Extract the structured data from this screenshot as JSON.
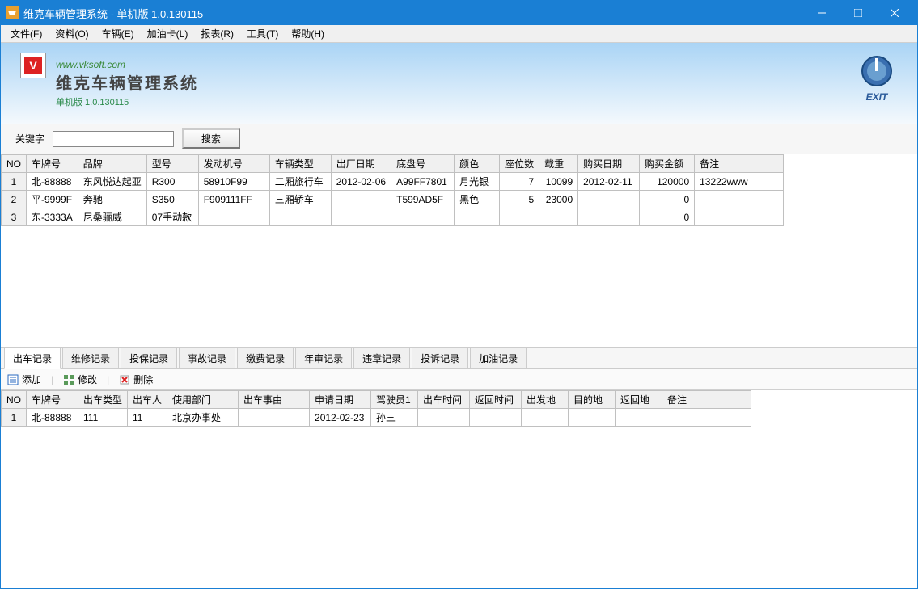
{
  "window": {
    "title": "维克车辆管理系统 - 单机版 1.0.130115"
  },
  "menu": {
    "file": "文件(F)",
    "data": "资料(O)",
    "vehicle": "车辆(E)",
    "fuelcard": "加油卡(L)",
    "report": "报表(R)",
    "tool": "工具(T)",
    "help": "帮助(H)"
  },
  "banner": {
    "url": "www.vksoft.com",
    "app_name": "维克车辆管理系统",
    "edition": "单机版 1.0.130115",
    "exit": "EXIT",
    "logo_letter": "V"
  },
  "search": {
    "label": "关键字",
    "value": "",
    "button": "搜索"
  },
  "vehicle_table": {
    "headers": {
      "no": "NO",
      "plate": "车牌号",
      "brand": "品牌",
      "model": "型号",
      "engine": "发动机号",
      "type": "车辆类型",
      "factory_date": "出厂日期",
      "chassis": "底盘号",
      "color": "颜色",
      "seats": "座位数",
      "load": "载重",
      "buy_date": "购买日期",
      "buy_amount": "购买金额",
      "remark": "备注"
    },
    "rows": [
      {
        "no": "1",
        "plate": "北-88888",
        "brand": "东风悦达起亚",
        "model": "R300",
        "engine": "58910F99",
        "type": "二厢旅行车",
        "factory_date": "2012-02-06",
        "chassis": "A99FF7801",
        "color": "月光银",
        "seats": "7",
        "load": "10099",
        "buy_date": "2012-02-11",
        "buy_amount": "120000",
        "remark": "13222www"
      },
      {
        "no": "2",
        "plate": "平-9999F",
        "brand": "奔驰",
        "model": "S350",
        "engine": "F909111FF",
        "type": "三厢轿车",
        "factory_date": "",
        "chassis": "T599AD5F",
        "color": "黑色",
        "seats": "5",
        "load": "23000",
        "buy_date": "",
        "buy_amount": "0",
        "remark": ""
      },
      {
        "no": "3",
        "plate": "东-3333A",
        "brand": "尼桑骊威",
        "model": "07手动款",
        "engine": "",
        "type": "",
        "factory_date": "",
        "chassis": "",
        "color": "",
        "seats": "",
        "load": "",
        "buy_date": "",
        "buy_amount": "0",
        "remark": ""
      }
    ]
  },
  "tabs": {
    "trip": "出车记录",
    "repair": "维修记录",
    "insure": "投保记录",
    "accident": "事故记录",
    "fee": "缴费记录",
    "annual": "年审记录",
    "violation": "违章记录",
    "complaint": "投诉记录",
    "fuel": "加油记录"
  },
  "toolbar": {
    "add": "添加",
    "edit": "修改",
    "delete": "删除"
  },
  "trip_table": {
    "headers": {
      "no": "NO",
      "plate": "车牌号",
      "type": "出车类型",
      "person": "出车人",
      "dept": "使用部门",
      "reason": "出车事由",
      "apply_date": "申请日期",
      "driver1": "驾驶员1",
      "out_time": "出车时间",
      "back_time": "返回时间",
      "from": "出发地",
      "to": "目的地",
      "return_place": "返回地",
      "remark": "备注"
    },
    "rows": [
      {
        "no": "1",
        "plate": "北-88888",
        "type": "111",
        "person": "11",
        "dept": "北京办事处",
        "reason": "",
        "apply_date": "2012-02-23",
        "driver1": "孙三",
        "out_time": "",
        "back_time": "",
        "from": "",
        "to": "",
        "return_place": "",
        "remark": ""
      }
    ]
  }
}
